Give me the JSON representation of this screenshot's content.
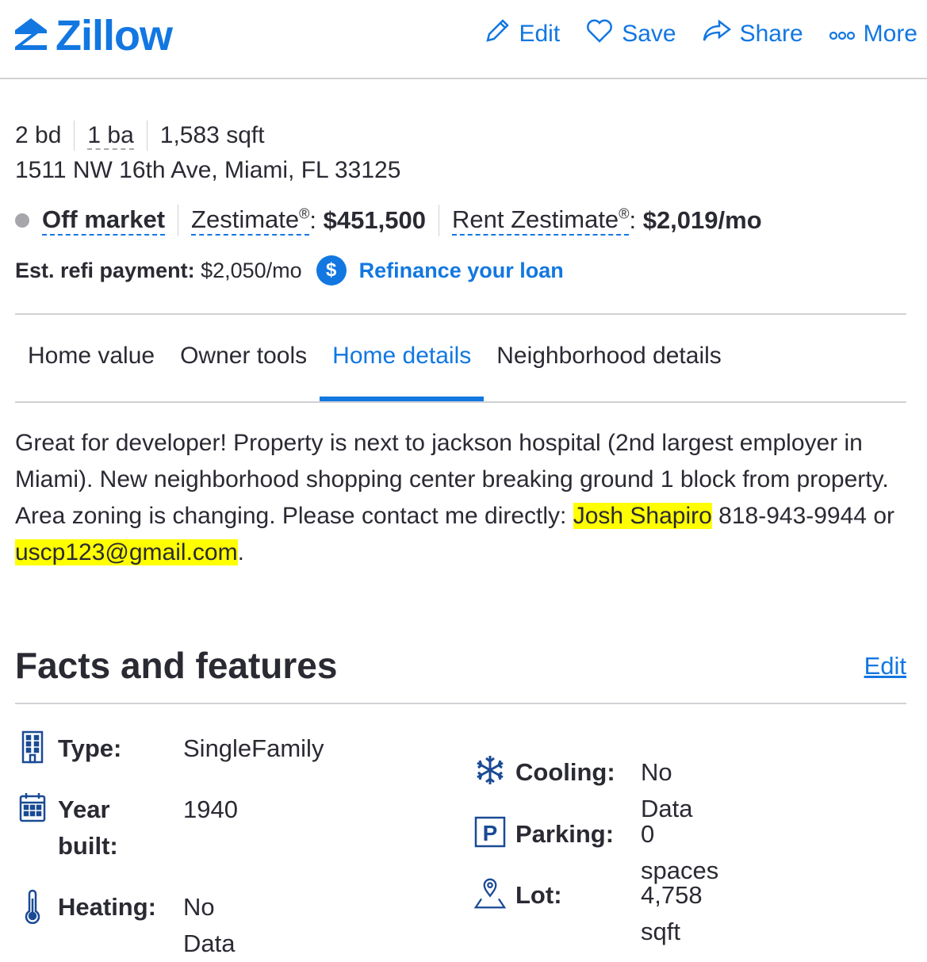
{
  "header": {
    "logo_text": "Zillow",
    "actions": [
      {
        "label": "Edit",
        "icon": "pencil-icon"
      },
      {
        "label": "Save",
        "icon": "heart-icon"
      },
      {
        "label": "Share",
        "icon": "share-arrow-icon"
      },
      {
        "label": "More",
        "icon": "more-dots-icon"
      }
    ]
  },
  "summary": {
    "beds": "2 bd",
    "baths": "1 ba",
    "sqft": "1,583 sqft",
    "address": "1511 NW 16th Ave, Miami, FL 33125",
    "status": "Off market",
    "zestimate_label": "Zestimate",
    "zestimate_value": "$451,500",
    "rent_label": "Rent Zestimate",
    "rent_value": "$2,019/mo",
    "registered_mark": "®",
    "colon": ":",
    "refi_label": "Est. refi payment:",
    "refi_value": "$2,050/mo",
    "refi_badge": "$",
    "refi_link": "Refinance your loan"
  },
  "tabs": [
    {
      "label": "Home value",
      "active": false
    },
    {
      "label": "Owner tools",
      "active": false
    },
    {
      "label": "Home details",
      "active": true
    },
    {
      "label": "Neighborhood details",
      "active": false
    }
  ],
  "description": {
    "text": "Great for developer!  Property is next to jackson hospital (2nd largest employer in Miami).  New neighborhood shopping center breaking ground 1 block from property.  Area zoning is changing.  Please contact me directly: ",
    "name": "Josh Shapiro",
    "phone_part": " 818-943-9944 or ",
    "email": "uscp123@gmail.com",
    "end": "."
  },
  "facts": {
    "title": "Facts and features",
    "edit_label": "Edit",
    "left": [
      {
        "label": "Type:",
        "value": "SingleFamily",
        "icon": "building-icon"
      },
      {
        "label": "Year built:",
        "value": "1940",
        "icon": "calendar-icon"
      },
      {
        "label": "Heating:",
        "value": "No Data",
        "icon": "thermometer-icon"
      }
    ],
    "right": [
      {
        "label": "Cooling:",
        "value": "No Data",
        "icon": "snowflake-icon"
      },
      {
        "label": "Parking:",
        "value": "0 spaces",
        "icon": "parking-icon"
      },
      {
        "label": "Lot:",
        "value": "4,758 sqft",
        "icon": "lot-pin-icon"
      }
    ]
  },
  "colors": {
    "brand_blue": "#1277e1",
    "icon_navy": "#1a4a95",
    "highlight": "#ffff00",
    "text": "#2a2a33"
  }
}
